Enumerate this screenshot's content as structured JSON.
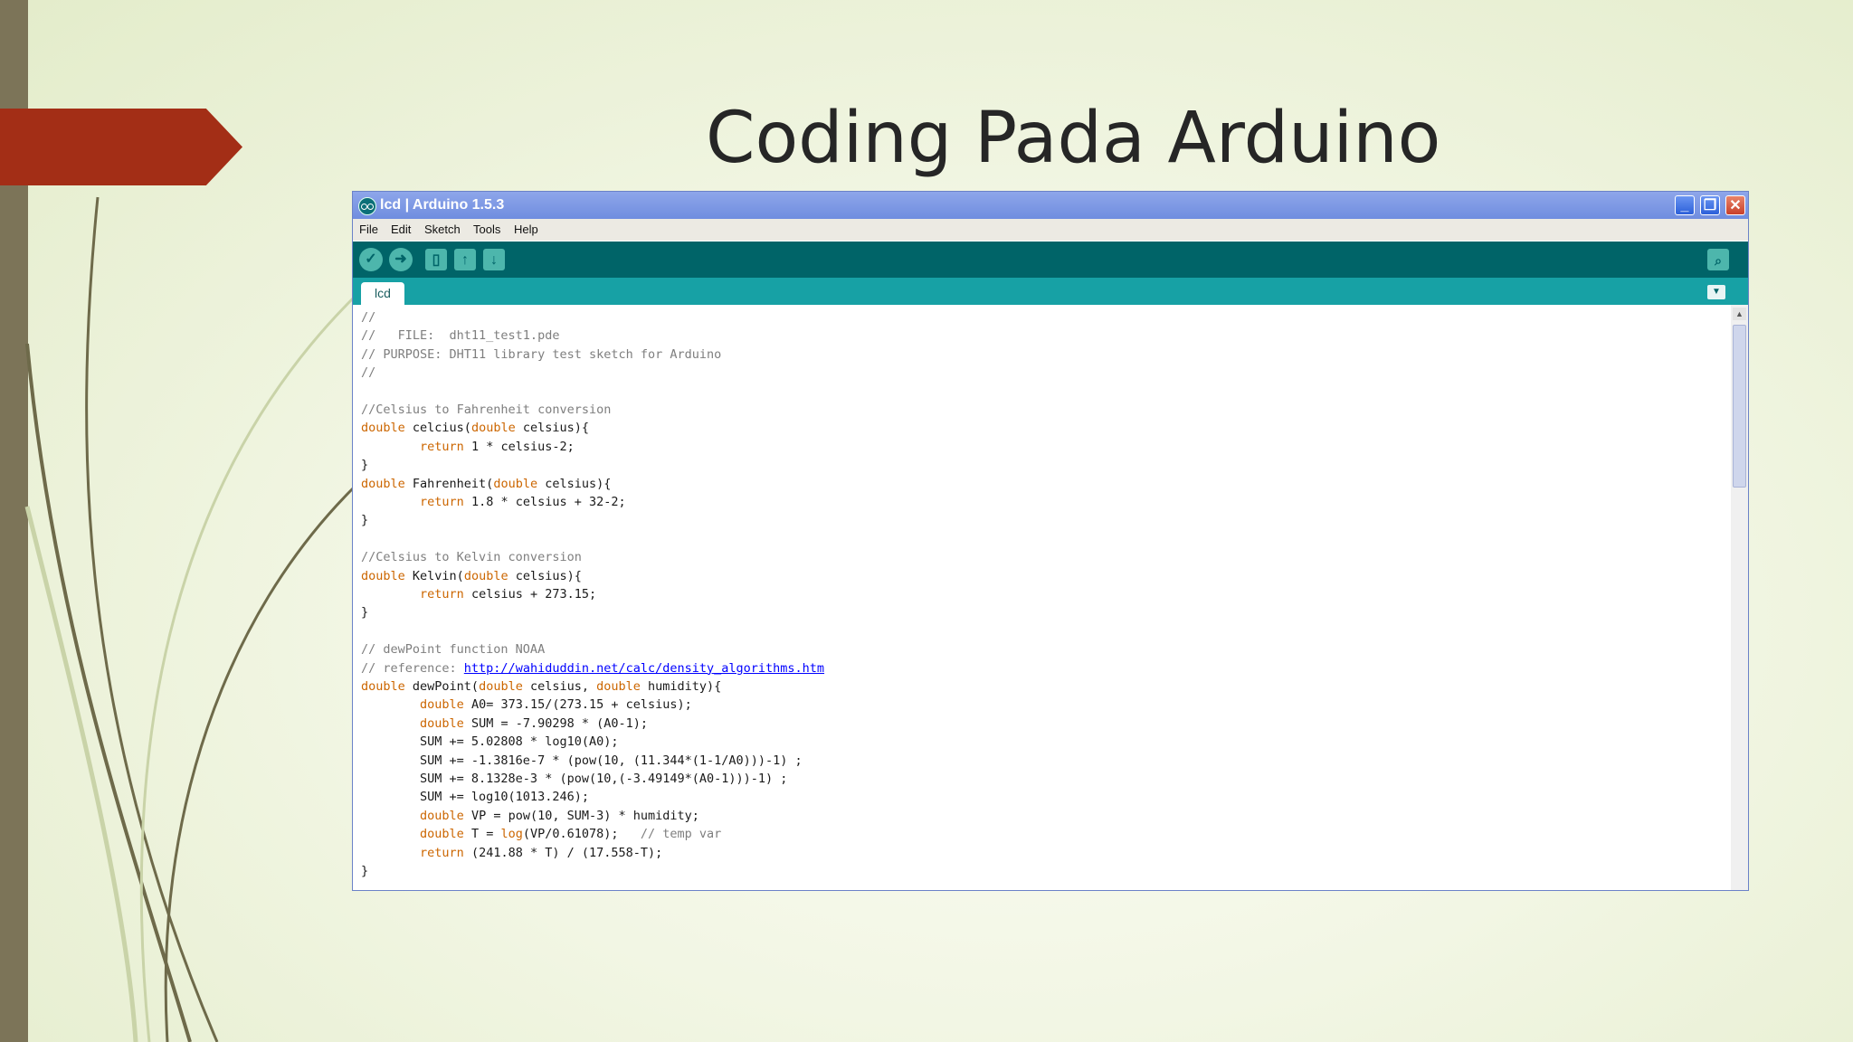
{
  "slide": {
    "title": "Coding Pada Arduino"
  },
  "window": {
    "title": "lcd | Arduino 1.5.3",
    "min_icon": "_",
    "max_icon": "❐",
    "close_icon": "✕"
  },
  "menu": [
    "File",
    "Edit",
    "Sketch",
    "Tools",
    "Help"
  ],
  "toolbar": {
    "verify": "✓",
    "upload": "➜",
    "new": "▯",
    "open": "↑",
    "save": "↓",
    "serial": "⌕"
  },
  "tab": {
    "label": "lcd",
    "menu_icon": "▼"
  },
  "scrollbar": {
    "up": "▲"
  },
  "code": [
    [
      {
        "t": "//",
        "c": "cm"
      }
    ],
    [
      {
        "t": "//   FILE:  dht11_test1.pde",
        "c": "cm"
      }
    ],
    [
      {
        "t": "// PURPOSE: DHT11 library test sketch for Arduino",
        "c": "cm"
      }
    ],
    [
      {
        "t": "//",
        "c": "cm"
      }
    ],
    [],
    [
      {
        "t": "//Celsius to Fahrenheit conversion",
        "c": "cm"
      }
    ],
    [
      {
        "t": "double",
        "c": "kw"
      },
      {
        "t": " celcius("
      },
      {
        "t": "double",
        "c": "kw"
      },
      {
        "t": " celsius){"
      }
    ],
    [
      {
        "t": "        "
      },
      {
        "t": "return",
        "c": "kw"
      },
      {
        "t": " 1 * celsius-2;"
      }
    ],
    [
      {
        "t": "}"
      }
    ],
    [
      {
        "t": "double",
        "c": "kw"
      },
      {
        "t": " Fahrenheit("
      },
      {
        "t": "double",
        "c": "kw"
      },
      {
        "t": " celsius){"
      }
    ],
    [
      {
        "t": "        "
      },
      {
        "t": "return",
        "c": "kw"
      },
      {
        "t": " 1.8 * celsius + 32-2;"
      }
    ],
    [
      {
        "t": "}"
      }
    ],
    [],
    [
      {
        "t": "//Celsius to Kelvin conversion",
        "c": "cm"
      }
    ],
    [
      {
        "t": "double",
        "c": "kw"
      },
      {
        "t": " Kelvin("
      },
      {
        "t": "double",
        "c": "kw"
      },
      {
        "t": " celsius){"
      }
    ],
    [
      {
        "t": "        "
      },
      {
        "t": "return",
        "c": "kw"
      },
      {
        "t": " celsius + 273.15;"
      }
    ],
    [
      {
        "t": "}"
      }
    ],
    [],
    [
      {
        "t": "// dewPoint function NOAA",
        "c": "cm"
      }
    ],
    [
      {
        "t": "// reference: ",
        "c": "cm"
      },
      {
        "t": "http://wahiduddin.net/calc/density_algorithms.htm",
        "c": "lnk"
      }
    ],
    [
      {
        "t": "double",
        "c": "kw"
      },
      {
        "t": " dewPoint("
      },
      {
        "t": "double",
        "c": "kw"
      },
      {
        "t": " celsius, "
      },
      {
        "t": "double",
        "c": "kw"
      },
      {
        "t": " humidity){"
      }
    ],
    [
      {
        "t": "        "
      },
      {
        "t": "double",
        "c": "kw"
      },
      {
        "t": " A0= 373.15/(273.15 + celsius);"
      }
    ],
    [
      {
        "t": "        "
      },
      {
        "t": "double",
        "c": "kw"
      },
      {
        "t": " SUM = -7.90298 * (A0-1);"
      }
    ],
    [
      {
        "t": "        SUM += 5.02808 * log10(A0);"
      }
    ],
    [
      {
        "t": "        SUM += -1.3816e-7 * (pow(10, (11.344*(1-1/A0)))-1) ;"
      }
    ],
    [
      {
        "t": "        SUM += 8.1328e-3 * (pow(10,(-3.49149*(A0-1)))-1) ;"
      }
    ],
    [
      {
        "t": "        SUM += log10(1013.246);"
      }
    ],
    [
      {
        "t": "        "
      },
      {
        "t": "double",
        "c": "kw"
      },
      {
        "t": " VP = pow(10, SUM-3) * humidity;"
      }
    ],
    [
      {
        "t": "        "
      },
      {
        "t": "double",
        "c": "kw"
      },
      {
        "t": " T = "
      },
      {
        "t": "log",
        "c": "kw"
      },
      {
        "t": "(VP/0.61078);   "
      },
      {
        "t": "// temp var",
        "c": "cm"
      }
    ],
    [
      {
        "t": "        "
      },
      {
        "t": "return",
        "c": "kw"
      },
      {
        "t": " (241.88 * T) / (17.558-T);"
      }
    ],
    [
      {
        "t": "}"
      }
    ]
  ]
}
